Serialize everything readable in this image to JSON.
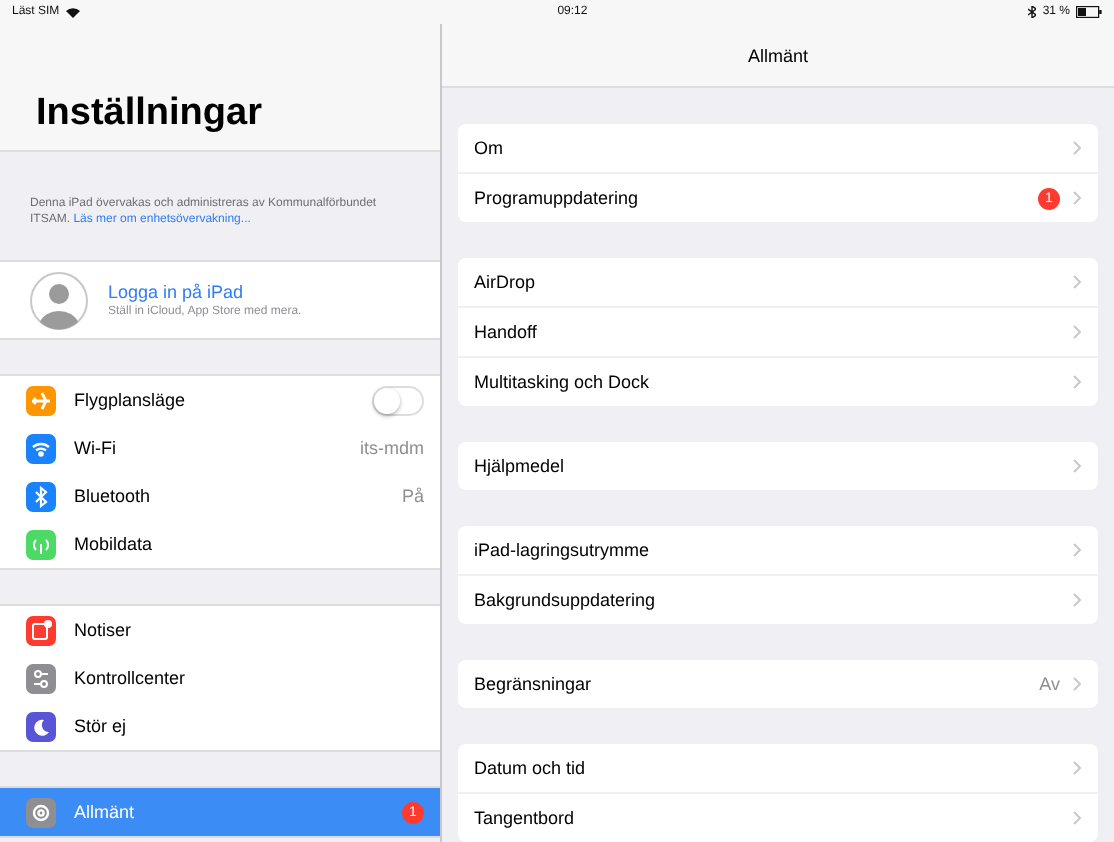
{
  "status_bar": {
    "carrier": "Läst SIM",
    "time": "09:12",
    "battery": "31 %"
  },
  "sidebar": {
    "title": "Inställningar",
    "notice": {
      "text": "Denna iPad övervakas och administreras av Kommunalförbundet ITSAM.",
      "link": "Läs mer om enhetsövervakning..."
    },
    "account": {
      "title": "Logga in på iPad",
      "subtitle": "Ställ in iCloud, App Store med mera."
    },
    "groups": [
      [
        {
          "label": "Flygplansläge",
          "kind": "toggle",
          "on": false,
          "selected": false
        },
        {
          "label": "Wi-Fi",
          "kind": "value",
          "value": "its-mdm",
          "selected": false
        },
        {
          "label": "Bluetooth",
          "kind": "value",
          "value": "På",
          "selected": false
        },
        {
          "label": "Mobildata",
          "kind": "plain",
          "selected": false
        }
      ],
      [
        {
          "label": "Notiser",
          "kind": "plain",
          "selected": false
        },
        {
          "label": "Kontrollcenter",
          "kind": "plain",
          "selected": false
        },
        {
          "label": "Stör ej",
          "kind": "plain",
          "selected": false
        }
      ],
      [
        {
          "label": "Allmänt",
          "kind": "badge",
          "badge": "1",
          "selected": true
        }
      ]
    ]
  },
  "detail": {
    "title": "Allmänt",
    "groups": [
      [
        {
          "label": "Om"
        },
        {
          "label": "Programuppdatering",
          "badge": "1"
        }
      ],
      [
        {
          "label": "AirDrop"
        },
        {
          "label": "Handoff"
        },
        {
          "label": "Multitasking och Dock"
        }
      ],
      [
        {
          "label": "Hjälpmedel"
        }
      ],
      [
        {
          "label": "iPad-lagringsutrymme"
        },
        {
          "label": "Bakgrundsuppdatering"
        }
      ],
      [
        {
          "label": "Begränsningar",
          "value": "Av"
        }
      ],
      [
        {
          "label": "Datum och tid"
        },
        {
          "label": "Tangentbord"
        }
      ]
    ]
  }
}
